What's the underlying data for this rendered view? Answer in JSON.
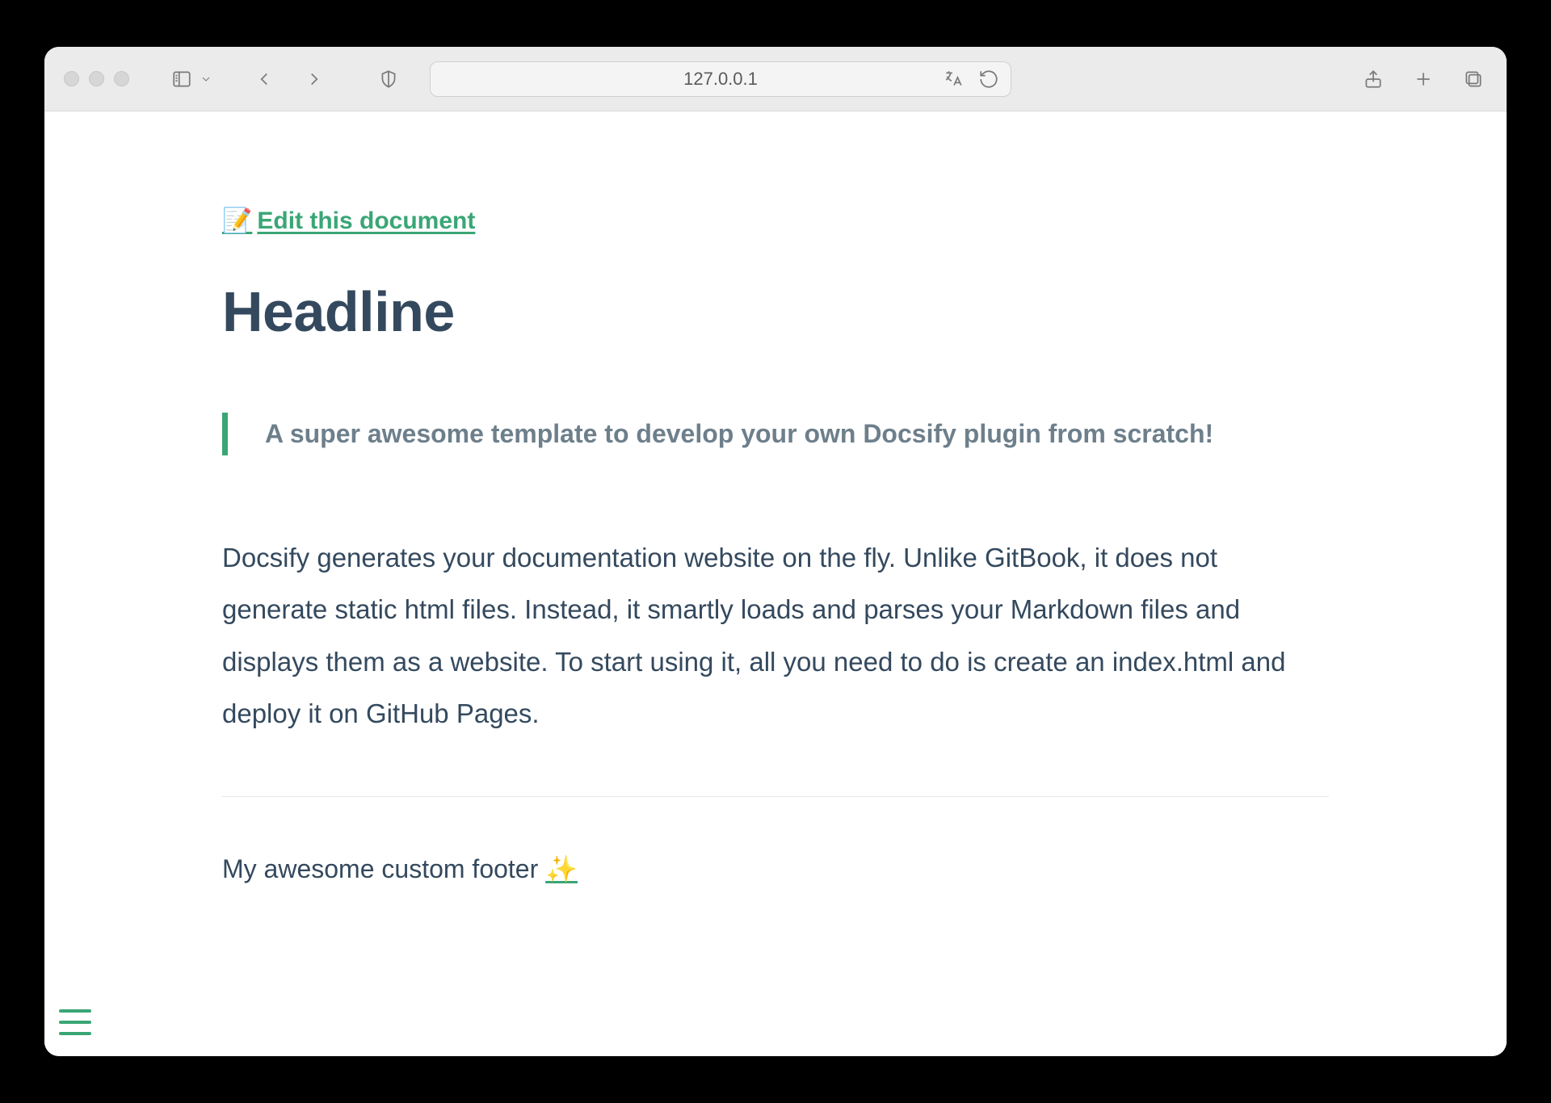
{
  "browser": {
    "address": "127.0.0.1"
  },
  "page": {
    "edit_link_text": " Edit this document",
    "edit_link_emoji": "📝",
    "headline": "Headline",
    "callout": "A super awesome template to develop your own Docsify plugin from scratch!",
    "body": "Docsify generates your documentation website on the fly. Unlike GitBook, it does not generate static html files. Instead, it smartly loads and parses your Markdown files and displays them as a website. To start using it, all you need to do is create an index.html and deploy it on GitHub Pages.",
    "footer_text": "My awesome custom footer ",
    "footer_emoji": "✨"
  }
}
